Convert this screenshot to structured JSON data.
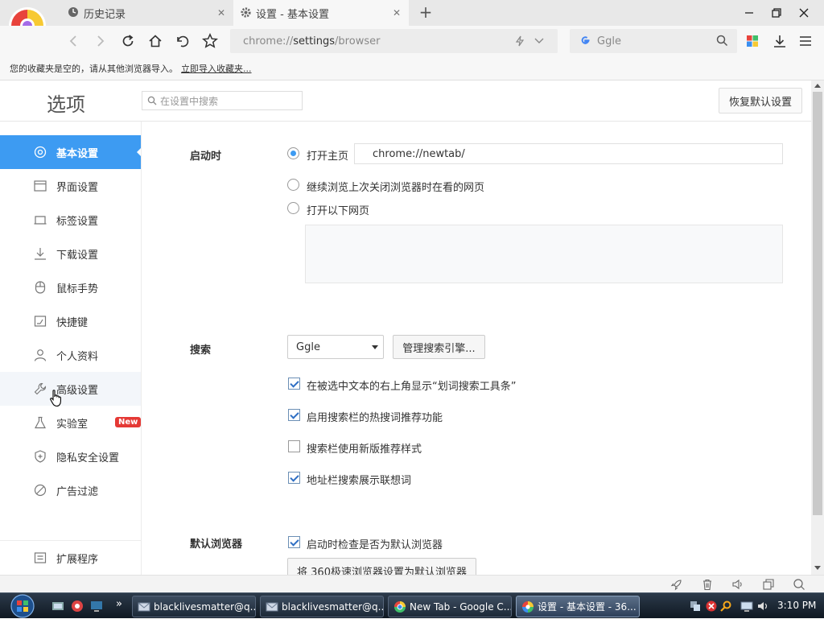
{
  "browser": {
    "tabs": [
      {
        "label": "历史记录",
        "icon": "history-icon"
      },
      {
        "label": "设置 - 基本设置",
        "icon": "gear-icon"
      }
    ],
    "new_tab": "+",
    "address": {
      "prefix": "chrome://",
      "host": "settings",
      "path": "/browser"
    },
    "search_placeholder": "Ggle",
    "bookmark_bar": {
      "text": "您的收藏夹是空的，请从其他浏览器导入。",
      "link": "立即导入收藏夹..."
    }
  },
  "options": {
    "title": "选项",
    "search_placeholder": "在设置中搜索",
    "restore_button": "恢复默认设置"
  },
  "sidebar": {
    "items": [
      {
        "label": "基本设置",
        "icon": "target-icon"
      },
      {
        "label": "界面设置",
        "icon": "window-icon"
      },
      {
        "label": "标签设置",
        "icon": "tab-icon"
      },
      {
        "label": "下载设置",
        "icon": "download-icon"
      },
      {
        "label": "鼠标手势",
        "icon": "mouse-icon"
      },
      {
        "label": "快捷键",
        "icon": "keyboard-icon"
      },
      {
        "label": "个人资料",
        "icon": "user-icon"
      },
      {
        "label": "高级设置",
        "icon": "wrench-icon"
      },
      {
        "label": "实验室",
        "icon": "flask-icon",
        "badge": "New"
      },
      {
        "label": "隐私安全设置",
        "icon": "shield-icon"
      },
      {
        "label": "广告过滤",
        "icon": "block-icon"
      }
    ],
    "extensions": {
      "label": "扩展程序",
      "icon": "extension-icon"
    }
  },
  "startup": {
    "heading": "启动时",
    "option_home": "打开主页",
    "home_url": "chrome://newtab/",
    "option_continue": "继续浏览上次关闭浏览器时在看的网页",
    "option_pages": "打开以下网页"
  },
  "search_section": {
    "heading": "搜索",
    "engine": "Ggle",
    "manage_button": "管理搜索引擎...",
    "checks": [
      {
        "label": "在被选中文本的右上角显示“划词搜索工具条”",
        "checked": true
      },
      {
        "label": "启用搜索栏的热搜词推荐功能",
        "checked": true
      },
      {
        "label": "搜索栏使用新版推荐样式",
        "checked": false
      },
      {
        "label": "地址栏搜索展示联想词",
        "checked": true
      }
    ]
  },
  "default_browser": {
    "heading": "默认浏览器",
    "check_label": "启动时检查是否为默认浏览器",
    "set_button": "将 360极速浏览器设置为默认浏览器"
  },
  "taskbar": {
    "items": [
      {
        "label": "blacklivesmatter@q...",
        "icon": "mail-icon"
      },
      {
        "label": "blacklivesmatter@q...",
        "icon": "mail-icon"
      },
      {
        "label": "New Tab - Google C...",
        "icon": "chrome-icon"
      },
      {
        "label": "设置 - 基本设置 - 36...",
        "icon": "browser-icon"
      }
    ],
    "overflow": "»",
    "clock": "3:10 PM"
  },
  "colors": {
    "accent": "#3d9bf2",
    "badge": "#e53935"
  }
}
